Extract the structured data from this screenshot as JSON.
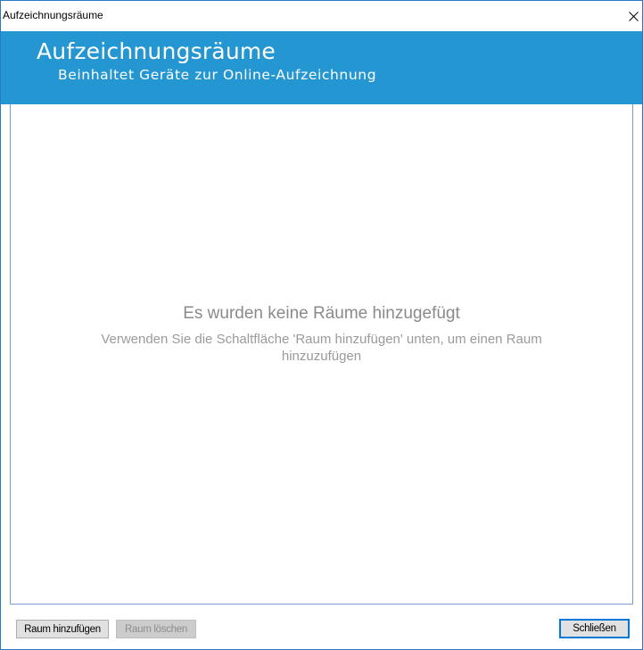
{
  "window": {
    "title": "Aufzeichnungsräume",
    "close_glyph": "✕",
    "close_icon": "close-icon"
  },
  "banner": {
    "heading": "Aufzeichnungsräume",
    "subheading": "Beinhaltet Geräte zur Online-Aufzeichnung",
    "background_color": "#2496d1"
  },
  "empty_state": {
    "title": "Es wurden keine Räume hinzugefügt",
    "description_line1": "Verwenden Sie die Schaltfläche 'Raum hinzufügen' unten, um einen Raum",
    "description_line2": "hinzuzufügen"
  },
  "footer": {
    "add_room_label": "Raum hinzufügen",
    "delete_room_label": "Raum löschen",
    "delete_room_enabled": false,
    "close_label": "Schließen"
  }
}
